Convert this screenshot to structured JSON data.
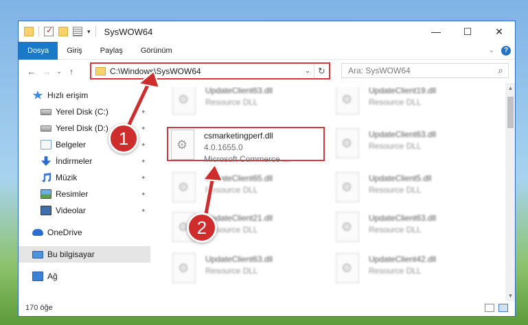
{
  "window": {
    "title": "SysWOW64",
    "controls": [
      "—",
      "☐",
      "✕"
    ]
  },
  "ribbon": {
    "tabs": [
      "Dosya",
      "Giriş",
      "Paylaş",
      "Görünüm"
    ],
    "collapse": "⌄",
    "help": "?"
  },
  "nav": {
    "back": "←",
    "forward": "→",
    "recent": "⌄",
    "up": "↑",
    "address": "C:\\Windows\\SysWOW64",
    "address_dropdown": "⌄",
    "refresh": "↻",
    "search_placeholder": "Ara: SysWOW64",
    "search_icon": "⌕"
  },
  "sidebar": {
    "items": [
      {
        "label": "Hızlı erişim",
        "icon": "star-icon"
      },
      {
        "label": "Yerel Disk (C:)",
        "icon": "drive-icon",
        "pinned": true
      },
      {
        "label": "Yerel Disk (D:)",
        "icon": "drive-icon",
        "pinned": true
      },
      {
        "label": "Belgeler",
        "icon": "documents-icon",
        "pinned": true
      },
      {
        "label": "İndirmeler",
        "icon": "downloads-icon",
        "pinned": true
      },
      {
        "label": "Müzik",
        "icon": "music-icon",
        "pinned": true
      },
      {
        "label": "Resimler",
        "icon": "pictures-icon",
        "pinned": true
      },
      {
        "label": "Videolar",
        "icon": "videos-icon",
        "pinned": true
      },
      {
        "label": "OneDrive",
        "icon": "onedrive-icon"
      },
      {
        "label": "Bu bilgisayar",
        "icon": "pc-icon",
        "selected": true
      },
      {
        "label": "Ağ",
        "icon": "network-icon"
      }
    ],
    "pin_glyph": "📌"
  },
  "files": {
    "highlighted": {
      "name": "csmarketingperf.dll",
      "version": "4.0.1655.0",
      "company": "Microsoft Commerce ..."
    },
    "left_column": [
      {
        "name": "UpdateClient63.dll",
        "type": "Resource DLL"
      },
      {
        "name": "UpdateClient65.dll",
        "type": "Resource DLL"
      },
      {
        "name": "UpdateClient21.dll",
        "type": "Resource DLL"
      },
      {
        "name": "UpdateClient63.dll",
        "type": "Resource DLL"
      }
    ],
    "right_column": [
      {
        "name": "UpdateClient19.dll",
        "type": "Resource DLL"
      },
      {
        "name": "UpdateClient63.dll",
        "type": "Resource DLL"
      },
      {
        "name": "UpdateClient5.dll",
        "type": "Resource DLL"
      },
      {
        "name": "UpdateClient63.dll",
        "type": "Resource DLL"
      },
      {
        "name": "UpdateClient42.dll",
        "type": "Resource DLL"
      }
    ]
  },
  "status": {
    "count": "170 öğe"
  },
  "annotations": {
    "step1": "1",
    "step2": "2",
    "color": "#cf2d2d"
  }
}
